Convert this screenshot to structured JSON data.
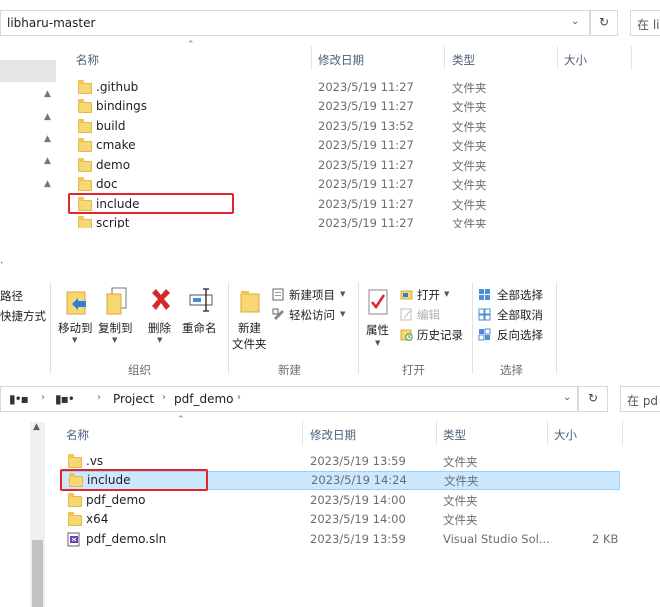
{
  "top_window": {
    "address": "libharu-master",
    "search_placeholder": "在 li",
    "columns": {
      "name": "名称",
      "date": "修改日期",
      "type": "类型",
      "size": "大小"
    },
    "rows": [
      {
        "name": ".github",
        "date": "2023/5/19 11:27",
        "type": "文件夹"
      },
      {
        "name": "bindings",
        "date": "2023/5/19 11:27",
        "type": "文件夹"
      },
      {
        "name": "build",
        "date": "2023/5/19 13:52",
        "type": "文件夹"
      },
      {
        "name": "cmake",
        "date": "2023/5/19 11:27",
        "type": "文件夹"
      },
      {
        "name": "demo",
        "date": "2023/5/19 11:27",
        "type": "文件夹"
      },
      {
        "name": "doc",
        "date": "2023/5/19 11:27",
        "type": "文件夹"
      },
      {
        "name": "include",
        "date": "2023/5/19 11:27",
        "type": "文件夹"
      },
      {
        "name": "script",
        "date": "2023/5/19 11:27",
        "type": "文件夹"
      }
    ]
  },
  "ribbon": {
    "left_partial": {
      "line1": "路径",
      "line2": "快捷方式"
    },
    "organize": {
      "move_to": "移动到",
      "copy_to": "复制到",
      "delete": "删除",
      "rename": "重命名",
      "group": "组织"
    },
    "new": {
      "new_folder_line1": "新建",
      "new_folder_line2": "文件夹",
      "new_item": "新建项目",
      "easy_access": "轻松访问",
      "group": "新建"
    },
    "open": {
      "properties": "属性",
      "open": "打开",
      "edit": "编辑",
      "history": "历史记录",
      "group": "打开"
    },
    "select": {
      "select_all": "全部选择",
      "select_none": "全部取消",
      "invert": "反向选择",
      "group": "选择"
    }
  },
  "bottom_window": {
    "breadcrumb": [
      "Project",
      "pdf_demo"
    ],
    "search_placeholder": "在 pd",
    "columns": {
      "name": "名称",
      "date": "修改日期",
      "type": "类型",
      "size": "大小"
    },
    "rows": [
      {
        "name": ".vs",
        "date": "2023/5/19 13:59",
        "type": "文件夹",
        "size": ""
      },
      {
        "name": "include",
        "date": "2023/5/19 14:24",
        "type": "文件夹",
        "size": ""
      },
      {
        "name": "pdf_demo",
        "date": "2023/5/19 14:00",
        "type": "文件夹",
        "size": ""
      },
      {
        "name": "x64",
        "date": "2023/5/19 14:00",
        "type": "文件夹",
        "size": ""
      },
      {
        "name": "pdf_demo.sln",
        "date": "2023/5/19 13:59",
        "type": "Visual Studio Sol...",
        "size": "2 KB"
      }
    ]
  },
  "colors": {
    "highlight_red": "#e0262b",
    "selected_row": "#cce8ff",
    "folder": "#f7d774"
  }
}
